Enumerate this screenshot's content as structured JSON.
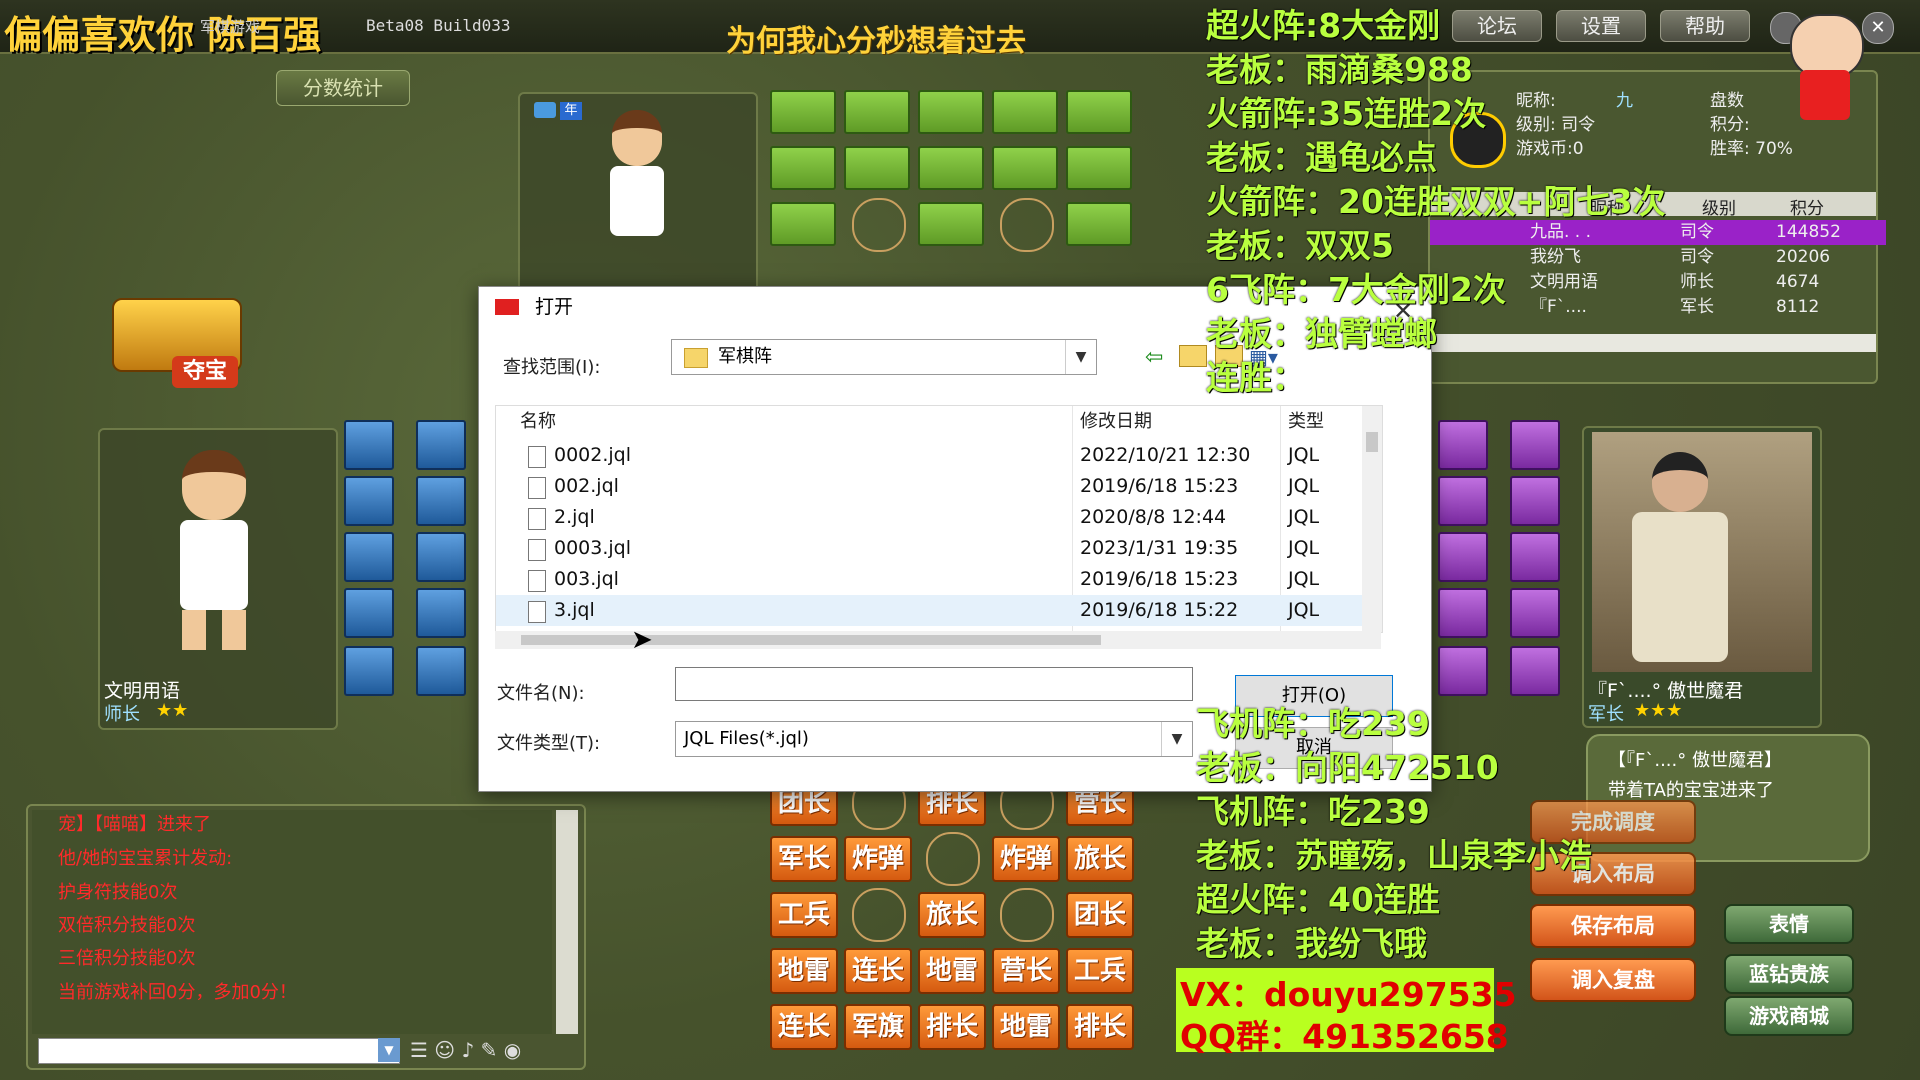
{
  "app": {
    "title": "军棋游戏",
    "version": "Beta08 Build033",
    "header_marquee": "为何我心分秒想着过去",
    "streamer_text": "偏偏喜欢你 陈百强",
    "top_buttons": [
      "论坛",
      "设置",
      "帮助"
    ]
  },
  "left": {
    "stats_button": "分数统计",
    "treasure_label": "夺宝",
    "player_name": "文明用语",
    "player_rank": "师长"
  },
  "right_player": {
    "name": "『F`....° 傲世魔君",
    "rank": "军长",
    "msg_name": "【『F`....° 傲世魔君】",
    "msg_text": "带着TA的宝宝进来了"
  },
  "profile": {
    "nickname_label": "昵称:",
    "nickname_suffix": "九",
    "level_label": "级别: 司令",
    "coins_label": "游戏币:0",
    "games_label": "盘数",
    "score_label": "积分:",
    "winrate_label": "胜率: 70%"
  },
  "rank_table": {
    "headers": [
      "昵称",
      "级别",
      "积分"
    ],
    "rows": [
      {
        "name": "九品. . .",
        "level": "司令",
        "score": "144852"
      },
      {
        "name": "我纷飞",
        "level": "司令",
        "score": "20206"
      },
      {
        "name": "文明用语",
        "level": "师长",
        "score": "4674"
      },
      {
        "name": "『F`....",
        "level": "军长",
        "score": "8112"
      }
    ]
  },
  "chat": {
    "lines": [
      "宠】【喵喵】进来了",
      "他/她的宝宝累计发动:",
      "护身符技能0次",
      "双倍积分技能0次",
      "三倍积分技能0次",
      "当前游戏补回0分，多加0分！"
    ]
  },
  "board_pieces": [
    [
      "团长",
      "",
      "排长",
      "",
      "营长"
    ],
    [
      "军长",
      "炸弹",
      "",
      "炸弹",
      "旅长"
    ],
    [
      "工兵",
      "",
      "旅长",
      "",
      "团长"
    ],
    [
      "地雷",
      "连长",
      "地雷",
      "营长",
      "工兵"
    ],
    [
      "连长",
      "军旗",
      "排长",
      "地雷",
      "排长"
    ]
  ],
  "side_buttons": {
    "complete": "完成调度",
    "load_layout": "调入布局",
    "save_layout": "保存布局",
    "load_replay": "调入复盘",
    "emoji": "表情",
    "blue_diamond": "蓝钻贵族",
    "shop": "游戏商城"
  },
  "overlay_text": [
    "超火阵:8大金刚",
    "老板：雨滴桑988",
    "火箭阵:35连胜2次",
    "老板：遇龟必点",
    "火箭阵：20连胜双双+阿七3次",
    "老板：双双5",
    "6飞阵：7大金刚2次",
    "老板：独臂螳螂",
    "连胜："
  ],
  "overlay_text2": [
    "飞机阵：吃239",
    "老板：向阳472510",
    "飞机阵：吃239",
    "老板：苏瞳殇，山泉李小浩",
    "超火阵：40连胜",
    "老板：我纷飞哦"
  ],
  "contact": {
    "vx": "VX：douyu297535",
    "qq": "QQ群：491352658"
  },
  "dialog": {
    "title": "打开",
    "lookin_label": "查找范围(I):",
    "lookin_value": "军棋阵",
    "col_name": "名称",
    "col_date": "修改日期",
    "col_type": "类型",
    "files": [
      {
        "name": "0002.jql",
        "date": "2022/10/21 12:30",
        "type": "JQL"
      },
      {
        "name": "002.jql",
        "date": "2019/6/18 15:23",
        "type": "JQL"
      },
      {
        "name": "2.jql",
        "date": "2020/8/8 12:44",
        "type": "JQL"
      },
      {
        "name": "0003.jql",
        "date": "2023/1/31 19:35",
        "type": "JQL"
      },
      {
        "name": "003.jql",
        "date": "2019/6/18 15:23",
        "type": "JQL"
      },
      {
        "name": "3.jql",
        "date": "2019/6/18 15:22",
        "type": "JQL"
      }
    ],
    "filename_label": "文件名(N):",
    "filename_value": "",
    "filetype_label": "文件类型(T):",
    "filetype_value": "JQL Files(*.jql)",
    "open_button": "打开(O)",
    "cancel_button": "取消"
  }
}
